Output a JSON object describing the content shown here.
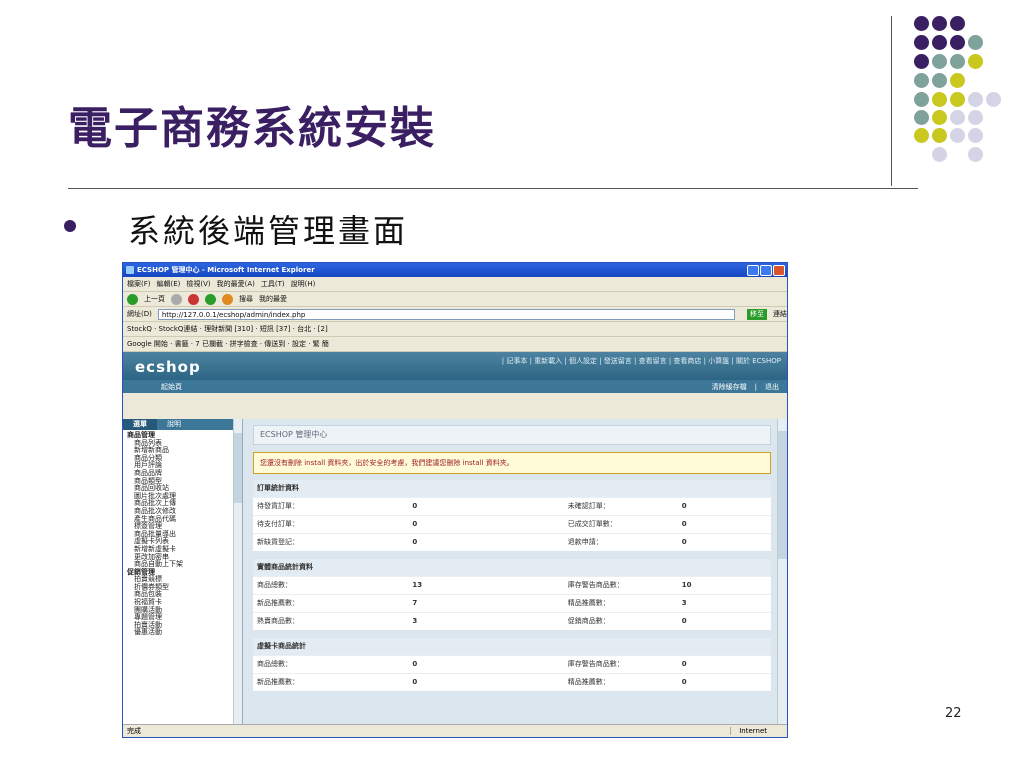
{
  "slide": {
    "title": "電子商務系統安裝",
    "bullet": "系統後端管理畫面",
    "page_number": "22",
    "accent_color": "#3b1f63"
  },
  "browser": {
    "window_title": "ECSHOP 管理中心 - Microsoft Internet Explorer",
    "menu": [
      "檔案(F)",
      "編輯(E)",
      "檢視(V)",
      "我的最愛(A)",
      "工具(T)",
      "說明(H)"
    ],
    "toolbar": {
      "back": "上一頁",
      "search": "搜尋",
      "favorites": "我的最愛"
    },
    "address_label": "網址(D)",
    "address": "http://127.0.0.1/ecshop/admin/index.php",
    "go_label": "移至",
    "links_label": "連結",
    "stockq_bar": "StockQ · StockQ連結 · 理財新聞 [310] · 短訊 [37] · 台北 · [2]",
    "google_bar": "Google  開始 · 書籤 · 7 已攔截 · 拼字檢查 · 傳送到 · 設定 · 繁 簡",
    "status_left": "完成",
    "status_zone": "Internet"
  },
  "ecshop": {
    "logo": "ecshop",
    "top_nav": "| 記事本 | 重新載入 | 個人設定 | 發送留言 | 查看留言 | 查看商店 | 小算盤 | 關於 ECSHOP",
    "home_link": "起始頁",
    "clear_cache": "清除緩存檔",
    "logout": "退出",
    "side_tabs": [
      "選單",
      "說明"
    ],
    "menu_groups": [
      {
        "name": "商品管理",
        "items": [
          "商品列表",
          "新增新商品",
          "商品分類",
          "用戶評論",
          "商品品牌",
          "商品類型",
          "商品回收站",
          "圖片批次處理",
          "商品批次上傳",
          "商品批次修改",
          "產生商品代碼",
          "標簽管理",
          "商品批量導出",
          "虛擬卡列表",
          "新增新虛擬卡",
          "更改加密串",
          "商品自動上下架"
        ]
      },
      {
        "name": "促銷管理",
        "items": [
          "拍賣競標",
          "折價券類型",
          "商品包裝",
          "祝福賀卡",
          "團購活動",
          "專題管理",
          "拍賣活動",
          "優惠活動"
        ]
      }
    ],
    "main_heading": "ECSHOP 管理中心",
    "warning": "您還沒有刪除 install 資料夾，出於安全的考慮，我們建議您刪除 install 資料夾。",
    "sections": [
      {
        "title": "訂單統計資料",
        "rows": [
          {
            "l1": "待發貨訂單：",
            "v1": "0",
            "r1": true,
            "l2": "未確認訂單：",
            "v2": "0",
            "r2": false
          },
          {
            "l1": "待支付訂單：",
            "v1": "0",
            "r1": false,
            "l2": "已成交訂單數：",
            "v2": "0",
            "r2": false
          },
          {
            "l1": "新缺貨登記：",
            "v1": "0",
            "r1": false,
            "l2": "退款申請：",
            "v2": "0",
            "r2": false
          }
        ]
      },
      {
        "title": "實體商品統計資料",
        "rows": [
          {
            "l1": "商品總數：",
            "v1": "13",
            "r1": false,
            "l2": "庫存警告商品數：",
            "v2": "10",
            "r2": true
          },
          {
            "l1": "新品推薦數：",
            "v1": "7",
            "r1": false,
            "l2": "精品推薦數：",
            "v2": "3",
            "r2": false
          },
          {
            "l1": "熱賣商品數：",
            "v1": "3",
            "r1": false,
            "l2": "促銷商品數：",
            "v2": "0",
            "r2": false
          }
        ]
      },
      {
        "title": "虛擬卡商品統計",
        "rows": [
          {
            "l1": "商品總數：",
            "v1": "0",
            "r1": false,
            "l2": "庫存警告商品數：",
            "v2": "0",
            "r2": true
          },
          {
            "l1": "新品推薦數：",
            "v1": "0",
            "r1": false,
            "l2": "精品推薦數：",
            "v2": "0",
            "r2": false
          }
        ]
      }
    ]
  }
}
